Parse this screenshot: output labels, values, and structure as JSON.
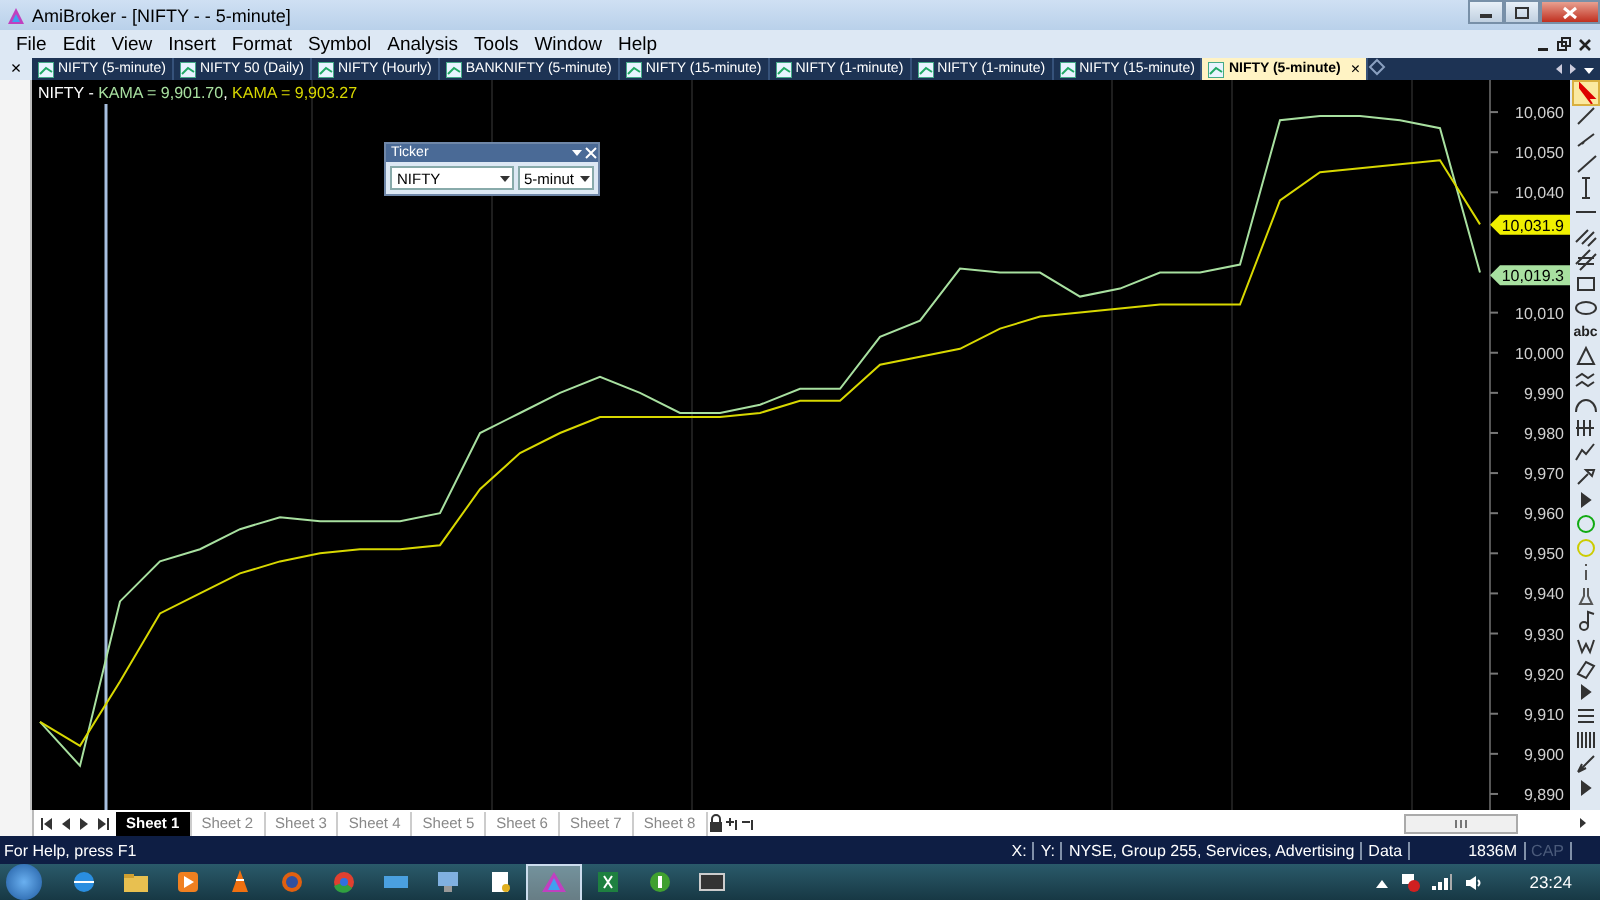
{
  "window": {
    "title": "AmiBroker - [NIFTY - - 5-minute]"
  },
  "menu": [
    "File",
    "Edit",
    "View",
    "Insert",
    "Format",
    "Symbol",
    "Analysis",
    "Tools",
    "Window",
    "Help"
  ],
  "tab_bar": {
    "close_glyph": "×",
    "tab_close": "×",
    "tabs": [
      {
        "label": "NIFTY (5-minute)",
        "selected": false
      },
      {
        "label": "NIFTY 50 (Daily)",
        "selected": false
      },
      {
        "label": "NIFTY (Hourly)",
        "selected": false
      },
      {
        "label": "BANKNIFTY (5-minute)",
        "selected": false
      },
      {
        "label": "NIFTY (15-minute)",
        "selected": false
      },
      {
        "label": "NIFTY (1-minute)",
        "selected": false
      },
      {
        "label": "NIFTY (1-minute)",
        "selected": false
      },
      {
        "label": "NIFTY (15-minute)",
        "selected": false
      },
      {
        "label": "NIFTY (5-minute)",
        "selected": true
      }
    ]
  },
  "chart": {
    "legend": [
      {
        "text": "NIFTY - ",
        "color": "#ffffff"
      },
      {
        "text": "KAMA = 9,901.70",
        "color": "#a8e0a0"
      },
      {
        "text": ", "
      },
      {
        "text": "KAMA = 9,903.27",
        "color": "#d8d800"
      }
    ],
    "price_tags": [
      {
        "text": "10,031.9",
        "color": "#f0f000"
      },
      {
        "text": "10,019.3",
        "color": "#a8e0a0"
      }
    ],
    "chart_data": {
      "type": "line",
      "ylim": [
        9886,
        10068
      ],
      "yticks": [
        {
          "value": 10060,
          "label": "10,060"
        },
        {
          "value": 10050,
          "label": "10,050"
        },
        {
          "value": 10040,
          "label": "10,040"
        },
        {
          "value": 10010,
          "label": "10,010"
        },
        {
          "value": 10000,
          "label": "10,000"
        },
        {
          "value": 9990,
          "label": "9,990"
        },
        {
          "value": 9980,
          "label": "9,980"
        },
        {
          "value": 9970,
          "label": "9,970"
        },
        {
          "value": 9960,
          "label": "9,960"
        },
        {
          "value": 9950,
          "label": "9,950"
        },
        {
          "value": 9940,
          "label": "9,940"
        },
        {
          "value": 9930,
          "label": "9,930"
        },
        {
          "value": 9920,
          "label": "9,920"
        },
        {
          "value": 9910,
          "label": "9,910"
        },
        {
          "value": 9900,
          "label": "9,900"
        },
        {
          "value": 9890,
          "label": "9,890"
        }
      ],
      "series": [
        {
          "color": "#a8e0a0",
          "values": [
            9908,
            9897,
            9938,
            9948,
            9951,
            9956,
            9959,
            9958,
            9958,
            9958,
            9960,
            9980,
            9985,
            9990,
            9994,
            9990,
            9985,
            9985,
            9987,
            9991,
            9991,
            10004,
            10008,
            10021,
            10020,
            10020,
            10014,
            10016,
            10020,
            10020,
            10022,
            10058,
            10059,
            10059,
            10058,
            10056,
            10020
          ]
        },
        {
          "color": "#d8d800",
          "values": [
            9908,
            9902,
            9918,
            9935,
            9940,
            9945,
            9948,
            9950,
            9951,
            9951,
            9952,
            9966,
            9975,
            9980,
            9984,
            9984,
            9984,
            9984,
            9985,
            9988,
            9988,
            9997,
            9999,
            10001,
            10006,
            10009,
            10010,
            10011,
            10012,
            10012,
            10012,
            10038,
            10045,
            10046,
            10047,
            10048,
            10032
          ]
        }
      ]
    }
  },
  "ticker_window": {
    "title": "Ticker",
    "symbol": "NIFTY",
    "interval": "5-minut"
  },
  "drawing_toolbar": {
    "text_tool": "abc"
  },
  "sheet_tabs": [
    {
      "label": "Sheet 1",
      "selected": true
    },
    {
      "label": "Sheet 2",
      "selected": false
    },
    {
      "label": "Sheet 3",
      "selected": false
    },
    {
      "label": "Sheet 4",
      "selected": false
    },
    {
      "label": "Sheet 5",
      "selected": false
    },
    {
      "label": "Sheet 6",
      "selected": false
    },
    {
      "label": "Sheet 7",
      "selected": false
    },
    {
      "label": "Sheet 8",
      "selected": false
    }
  ],
  "status_bar": {
    "help": "For Help, press F1",
    "fields": [
      {
        "text": "X:",
        "disabled": false
      },
      {
        "text": "Y:",
        "disabled": false
      },
      {
        "text": "NYSE, Group 255, Services, Advertising",
        "disabled": false
      },
      {
        "text": "Data",
        "disabled": false
      },
      {
        "text": "1836M",
        "disabled": false
      },
      {
        "text": "CAP",
        "disabled": true
      }
    ]
  },
  "taskbar": {
    "clock": "23:24"
  }
}
